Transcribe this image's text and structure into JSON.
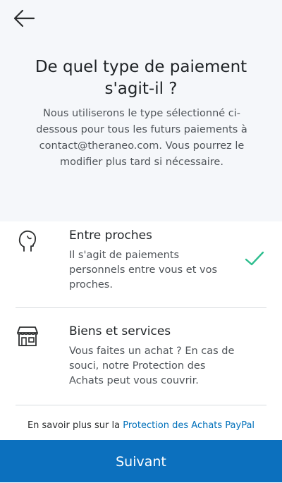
{
  "header": {
    "back_icon": "arrow-left-icon",
    "title": "De quel type de paiement s'agit-il ?",
    "subtitle": "Nous utiliserons le type sélectionné ci-dessous pour tous les futurs paiements à contact@theraneo.com. Vous pourrez le modifier plus tard si nécessaire."
  },
  "options": [
    {
      "icon": "person-head-icon",
      "title": "Entre proches",
      "description": "Il s'agit de paiements personnels entre vous et vos proches.",
      "selected": true,
      "check_icon": "checkmark-icon"
    },
    {
      "icon": "storefront-icon",
      "title": "Biens et services",
      "description": "Vous faites un achat ? En cas de souci, notre Protection des Achats peut vous couvrir.",
      "selected": false
    }
  ],
  "footer": {
    "text": "En savoir plus sur la ",
    "link": "Protection des Achats PayPal"
  },
  "next_button": {
    "label": "Suivant"
  },
  "colors": {
    "accent": "#0c70be",
    "link": "#0070ba",
    "check": "#2fbe8f",
    "header_bg": "#f5f7fa"
  }
}
